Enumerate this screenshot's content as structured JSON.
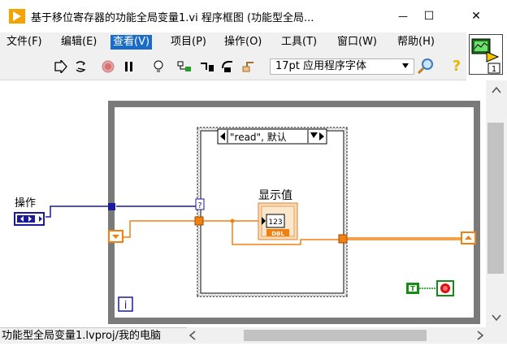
{
  "window": {
    "title": "基于移位寄存器的功能全局变量1.vi 程序框图 (功能型全局...",
    "minimize": "—",
    "maximize": "☐",
    "close": "✕"
  },
  "menu": {
    "items": [
      {
        "label": "文件(F)"
      },
      {
        "label": "编辑(E)"
      },
      {
        "label": "查看(V)"
      },
      {
        "label": "项目(P)"
      },
      {
        "label": "操作(O)"
      },
      {
        "label": "工具(T)"
      },
      {
        "label": "窗口(W)"
      },
      {
        "label": "帮助(H)"
      }
    ],
    "active_index": 2
  },
  "toolbar": {
    "font_select": "17pt 应用程序字体",
    "context_help_badge": "1"
  },
  "diagram": {
    "control_label": "操作",
    "case_selector": "\"read\", 默认",
    "indicator_label": "显示值",
    "indicator_value": "123",
    "indicator_type": "DBL",
    "iteration_terminal": "i",
    "bool_constant": "T",
    "case_selector_terminal": "?"
  },
  "status": {
    "path": "功能型全局变量1.lvproj/我的电脑"
  },
  "colors": {
    "menu_active": "#1a6cc8",
    "loop_border": "#7a7a7a",
    "enum_wire": "#1a1a9a",
    "dbl_wire": "#f08010",
    "stop_green": "#188a18",
    "stop_red": "#e01010"
  }
}
